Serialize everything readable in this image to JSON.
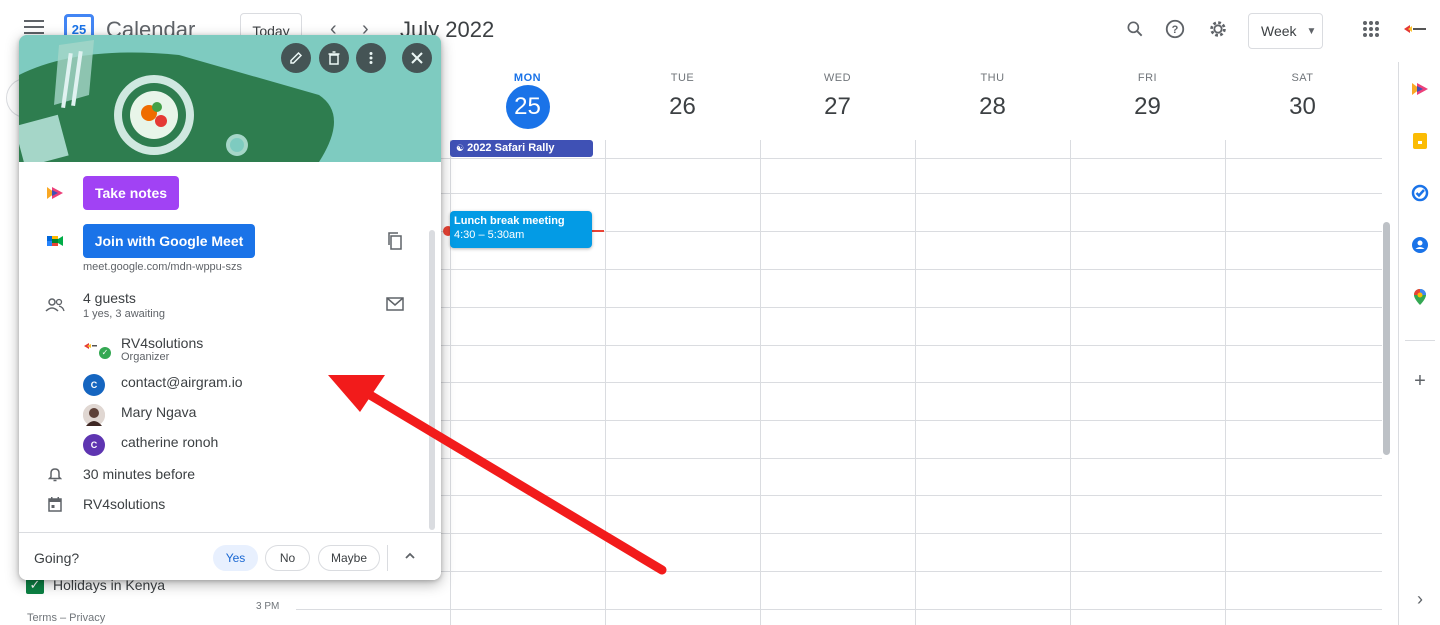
{
  "header": {
    "app_title": "Calendar",
    "logo_day": "25",
    "today_label": "Today",
    "prev_arrow": "‹",
    "next_arrow": "›",
    "month_title": "July 2022",
    "view_select": "Week"
  },
  "days": [
    {
      "name": "MON",
      "num": "25",
      "today": true
    },
    {
      "name": "TUE",
      "num": "26"
    },
    {
      "name": "WED",
      "num": "27"
    },
    {
      "name": "THU",
      "num": "28"
    },
    {
      "name": "FRI",
      "num": "29"
    },
    {
      "name": "SAT",
      "num": "30"
    }
  ],
  "events": {
    "allday_title": "2022 Safari Rally",
    "timed_title": "Lunch break meeting",
    "timed_time": "4:30 – 5:30am"
  },
  "sidebar": {
    "holiday_label": "Holidays in Kenya",
    "terms": "Terms – Privacy",
    "time_label": "3 PM"
  },
  "popup": {
    "take_notes": "Take notes",
    "join_meet": "Join with Google Meet",
    "meet_link": "meet.google.com/mdn-wppu-szs",
    "guests_title": "4 guests",
    "guests_sub": "1 yes, 3 awaiting",
    "guests": [
      {
        "name": "RV4solutions",
        "role": "Organizer",
        "initial": "",
        "color": "#ffffff"
      },
      {
        "name": "contact@airgram.io",
        "role": "",
        "initial": "C",
        "color": "#1565c0"
      },
      {
        "name": "Mary Ngava",
        "role": "",
        "initial": "",
        "color": "#8d6e63"
      },
      {
        "name": "catherine ronoh",
        "role": "",
        "initial": "C",
        "color": "#5e35b1"
      }
    ],
    "reminder": "30 minutes before",
    "calendar_name": "RV4solutions",
    "going_label": "Going?",
    "rsvp_yes": "Yes",
    "rsvp_no": "No",
    "rsvp_maybe": "Maybe"
  },
  "colors": {
    "accent": "#1a73e8",
    "allday_event": "#3f51b5",
    "timed_event": "#039be5",
    "notes_button": "#a142f4",
    "now_line": "#ea4335",
    "annotation_arrow": "#f21b1b"
  }
}
